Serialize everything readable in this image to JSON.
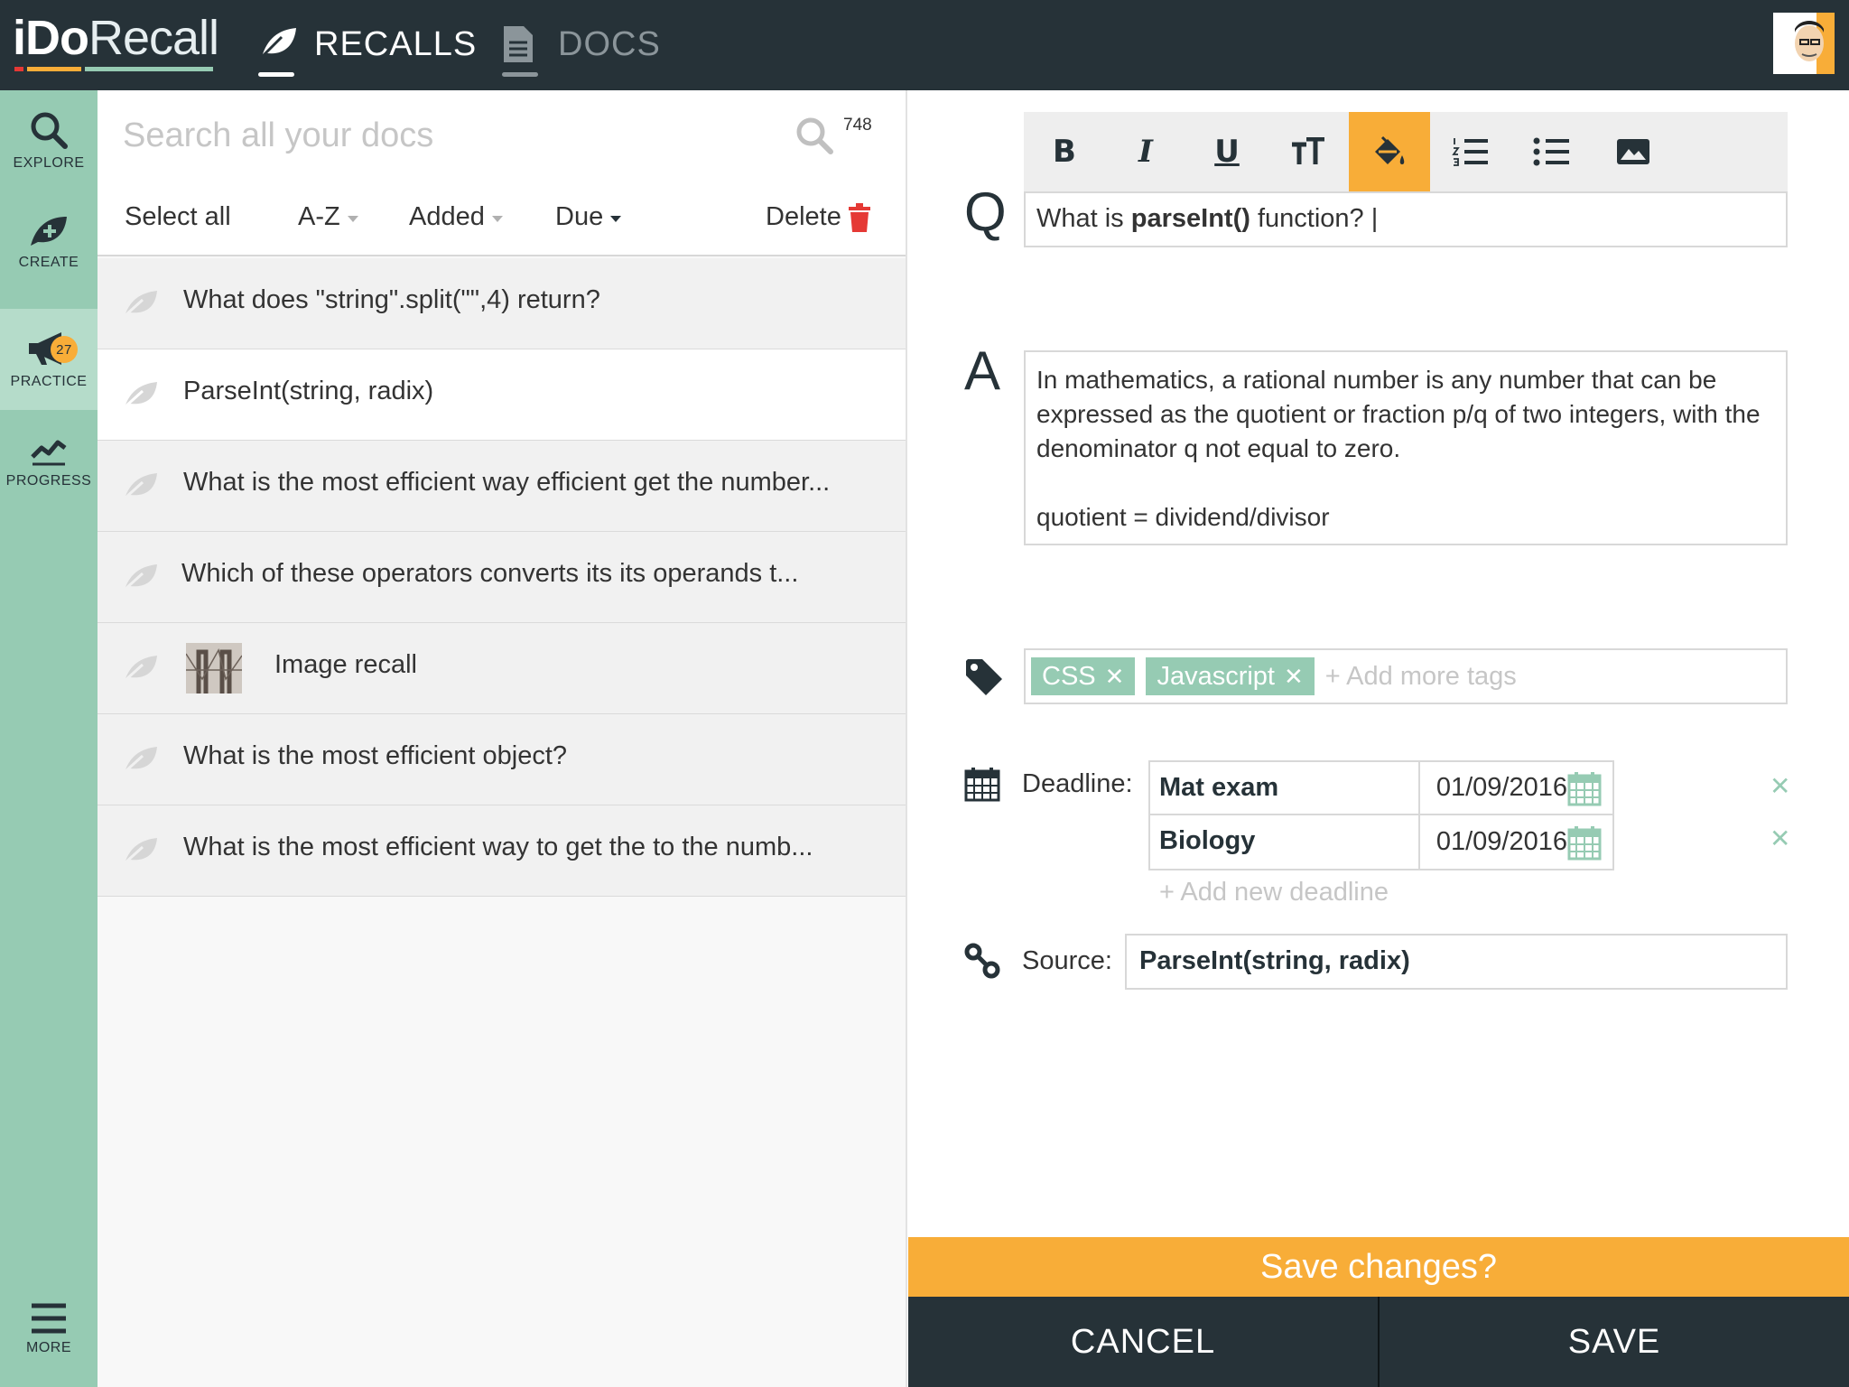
{
  "app": {
    "logo_bold": "iDo",
    "logo_light": "Recall",
    "colors": {
      "dark": "#263238",
      "green": "#96cbb3",
      "orange": "#f8ad38",
      "red": "#e53935"
    }
  },
  "nav": {
    "recalls": {
      "label": "RECALLS",
      "icon": "leaf-icon"
    },
    "docs": {
      "label": "DOCS",
      "icon": "document-icon"
    }
  },
  "rail": {
    "explore": "EXPLORE",
    "create": "CREATE",
    "practice": "PRACTICE",
    "practice_badge": "27",
    "progress": "PROGRESS",
    "more": "MORE"
  },
  "list": {
    "search_placeholder": "Search all your docs",
    "count": "748",
    "toolbar": {
      "select_all": "Select all",
      "sort_az": "A-Z",
      "sort_added": "Added",
      "sort_due": "Due",
      "delete": "Delete"
    },
    "items": [
      {
        "text": "What does \"string\".split(\"\",4) return?"
      },
      {
        "text": "ParseInt(string, radix)"
      },
      {
        "text": "What is the most efficient way efficient get the number..."
      },
      {
        "text": "Which of these operators converts its its operands t..."
      },
      {
        "text": "Image recall"
      },
      {
        "text": "What is the most efficient object?"
      },
      {
        "text": "What is the most efficient way to get the to  the numb..."
      }
    ]
  },
  "editor": {
    "q_letter": "Q",
    "a_letter": "A",
    "question_pre": "What is ",
    "question_bold": "parseInt()",
    "question_post": " function? |",
    "answer_line1": "In mathematics, a rational number is any number that can be expressed as the quotient or fraction p/q of two integers, with the denominator q not equal to zero.",
    "answer_line2": "quotient = dividend/divisor",
    "tags": [
      "CSS",
      "Javascript"
    ],
    "add_tags": "+ Add more tags",
    "deadline_label": "Deadline:",
    "deadlines": [
      {
        "name": "Mat exam",
        "date": "01/09/2016"
      },
      {
        "name": "Biology",
        "date": "01/09/2016"
      }
    ],
    "add_deadline": "+ Add new deadline",
    "source_label": "Source:",
    "source_value": "ParseInt(string, radix)",
    "save_prompt": "Save changes?",
    "cancel": "CANCEL",
    "save": "SAVE"
  }
}
